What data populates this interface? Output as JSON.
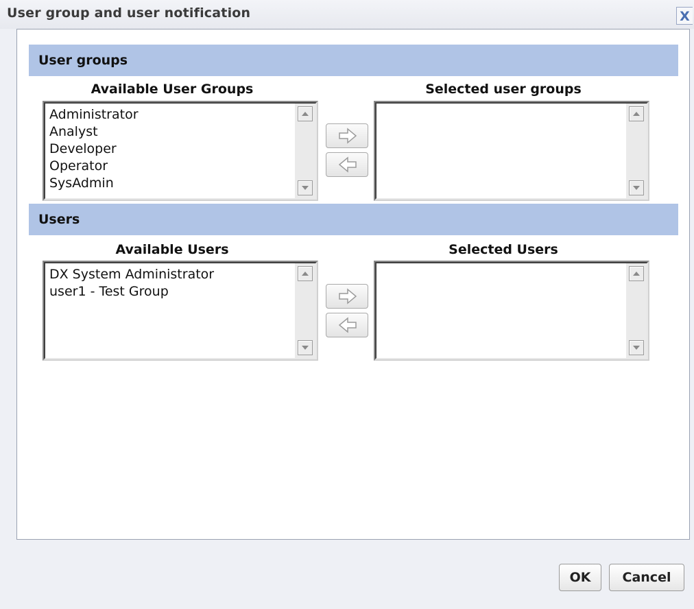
{
  "dialog": {
    "title": "User group and user notification",
    "close_label": "X"
  },
  "groups": {
    "header": "User groups",
    "available_label": "Available User Groups",
    "selected_label": "Selected user groups",
    "available_items": [
      "Administrator",
      "Analyst",
      "Developer",
      "Operator",
      "SysAdmin"
    ],
    "selected_items": []
  },
  "users": {
    "header": "Users",
    "available_label": "Available Users",
    "selected_label": "Selected Users",
    "available_items": [
      "DX System Administrator",
      "user1 - Test Group"
    ],
    "selected_items": []
  },
  "footer": {
    "ok_label": "OK",
    "cancel_label": "Cancel"
  },
  "icons": {
    "move_right": "arrow-right-icon",
    "move_left": "arrow-left-icon",
    "scroll_up": "scroll-up-icon",
    "scroll_down": "scroll-down-icon"
  },
  "colors": {
    "section_header_bg": "#b0c4e6",
    "dialog_bg": "#eef0f5",
    "close_accent": "#4a6fb1"
  }
}
